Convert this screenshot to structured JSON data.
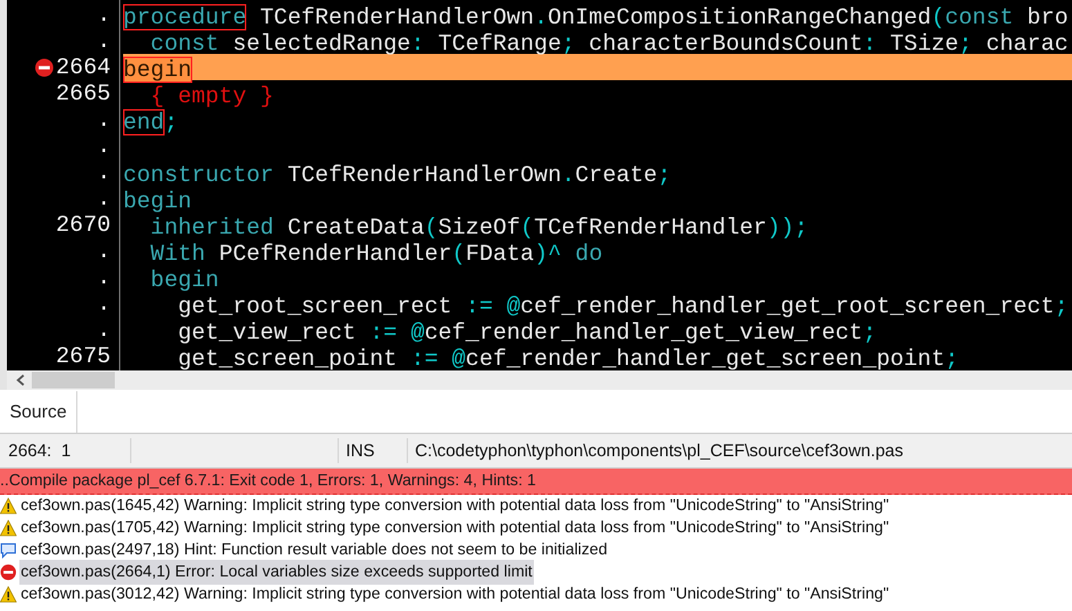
{
  "editor": {
    "lines": [
      {
        "gutter": ".",
        "error": false,
        "highlighted": false,
        "tokens": [
          {
            "kind": "matched",
            "text": "procedure"
          },
          {
            "kind": "ident",
            "text": " TCefRenderHandlerOwn"
          },
          {
            "kind": "symbol",
            "text": "."
          },
          {
            "kind": "ident",
            "text": "OnImeCompositionRangeChanged"
          },
          {
            "kind": "symbol",
            "text": "("
          },
          {
            "kind": "keyword",
            "text": "const"
          },
          {
            "kind": "ident",
            "text": " bro"
          }
        ]
      },
      {
        "gutter": ".",
        "error": false,
        "highlighted": false,
        "tokens": [
          {
            "kind": "keyword",
            "text": "  const"
          },
          {
            "kind": "ident",
            "text": " selectedRange"
          },
          {
            "kind": "symbol",
            "text": ":"
          },
          {
            "kind": "ident",
            "text": " TCefRange"
          },
          {
            "kind": "symbol",
            "text": ";"
          },
          {
            "kind": "ident",
            "text": " characterBoundsCount"
          },
          {
            "kind": "symbol",
            "text": ":"
          },
          {
            "kind": "ident",
            "text": " TSize"
          },
          {
            "kind": "symbol",
            "text": ";"
          },
          {
            "kind": "ident",
            "text": " charac"
          }
        ]
      },
      {
        "gutter": "2664",
        "error": true,
        "highlighted": true,
        "tokens": [
          {
            "kind": "matched",
            "text": "begin"
          }
        ]
      },
      {
        "gutter": "2665",
        "error": false,
        "highlighted": false,
        "tokens": [
          {
            "kind": "comment",
            "text": "  { empty }"
          }
        ]
      },
      {
        "gutter": ".",
        "error": false,
        "highlighted": false,
        "tokens": [
          {
            "kind": "matched",
            "text": "end"
          },
          {
            "kind": "symbol",
            "text": ";"
          }
        ]
      },
      {
        "gutter": ".",
        "error": false,
        "highlighted": false
      },
      {
        "gutter": ".",
        "error": false,
        "highlighted": false,
        "tokens": [
          {
            "kind": "keyword",
            "text": "constructor"
          },
          {
            "kind": "ident",
            "text": " TCefRenderHandlerOwn"
          },
          {
            "kind": "symbol",
            "text": "."
          },
          {
            "kind": "ident",
            "text": "Create"
          },
          {
            "kind": "symbol",
            "text": ";"
          }
        ]
      },
      {
        "gutter": ".",
        "error": false,
        "highlighted": false,
        "tokens": [
          {
            "kind": "keyword",
            "text": "begin"
          }
        ]
      },
      {
        "gutter": "2670",
        "error": false,
        "highlighted": false,
        "tokens": [
          {
            "kind": "keyword",
            "text": "  inherited"
          },
          {
            "kind": "ident",
            "text": " CreateData"
          },
          {
            "kind": "symbol",
            "text": "("
          },
          {
            "kind": "ident",
            "text": "SizeOf"
          },
          {
            "kind": "symbol",
            "text": "("
          },
          {
            "kind": "ident",
            "text": "TCefRenderHandler"
          },
          {
            "kind": "symbol",
            "text": "));"
          }
        ]
      },
      {
        "gutter": ".",
        "error": false,
        "highlighted": false,
        "tokens": [
          {
            "kind": "keyword",
            "text": "  With"
          },
          {
            "kind": "ident",
            "text": " PCefRenderHandler"
          },
          {
            "kind": "symbol",
            "text": "("
          },
          {
            "kind": "ident",
            "text": "FData"
          },
          {
            "kind": "symbol",
            "text": ")^ "
          },
          {
            "kind": "keyword",
            "text": "do"
          }
        ]
      },
      {
        "gutter": ".",
        "error": false,
        "highlighted": false,
        "tokens": [
          {
            "kind": "keyword",
            "text": "  begin"
          }
        ]
      },
      {
        "gutter": ".",
        "error": false,
        "highlighted": false,
        "tokens": [
          {
            "kind": "ident",
            "text": "    get_root_screen_rect "
          },
          {
            "kind": "symbol",
            "text": ":= @"
          },
          {
            "kind": "ident",
            "text": "cef_render_handler_get_root_screen_rect"
          },
          {
            "kind": "symbol",
            "text": ";"
          }
        ]
      },
      {
        "gutter": ".",
        "error": false,
        "highlighted": false,
        "tokens": [
          {
            "kind": "ident",
            "text": "    get_view_rect "
          },
          {
            "kind": "symbol",
            "text": ":= @"
          },
          {
            "kind": "ident",
            "text": "cef_render_handler_get_view_rect"
          },
          {
            "kind": "symbol",
            "text": ";"
          }
        ]
      },
      {
        "gutter": "2675",
        "error": false,
        "highlighted": false,
        "tokens": [
          {
            "kind": "ident",
            "text": "    get_screen_point "
          },
          {
            "kind": "symbol",
            "text": ":= @"
          },
          {
            "kind": "ident",
            "text": "cef_render_handler_get_screen_point"
          },
          {
            "kind": "symbol",
            "text": ";"
          }
        ]
      }
    ]
  },
  "tabs": [
    {
      "label": "Source",
      "selected": true
    }
  ],
  "status_bar": {
    "position": "2664:  1",
    "mode": "INS",
    "file": "C:\\codetyphon\\typhon\\components\\pl_CEF\\source\\cef3own.pas"
  },
  "messages": {
    "header": "..Compile package pl_cef 6.7.1: Exit code 1, Errors: 1, Warnings: 4, Hints: 1",
    "items": [
      {
        "kind": "warning",
        "selected": false,
        "text": "cef3own.pas(1645,42) Warning: Implicit string type conversion with potential data loss from \"UnicodeString\" to \"AnsiString\""
      },
      {
        "kind": "warning",
        "selected": false,
        "text": "cef3own.pas(1705,42) Warning: Implicit string type conversion with potential data loss from \"UnicodeString\" to \"AnsiString\""
      },
      {
        "kind": "hint",
        "selected": false,
        "text": "cef3own.pas(2497,18) Hint: Function result variable does not seem to be initialized"
      },
      {
        "kind": "error",
        "selected": true,
        "text": "cef3own.pas(2664,1) Error: Local variables size exceeds supported limit"
      },
      {
        "kind": "warning",
        "selected": false,
        "text": "cef3own.pas(3012,42) Warning: Implicit string type conversion with potential data loss from \"UnicodeString\" to \"AnsiString\""
      }
    ]
  }
}
